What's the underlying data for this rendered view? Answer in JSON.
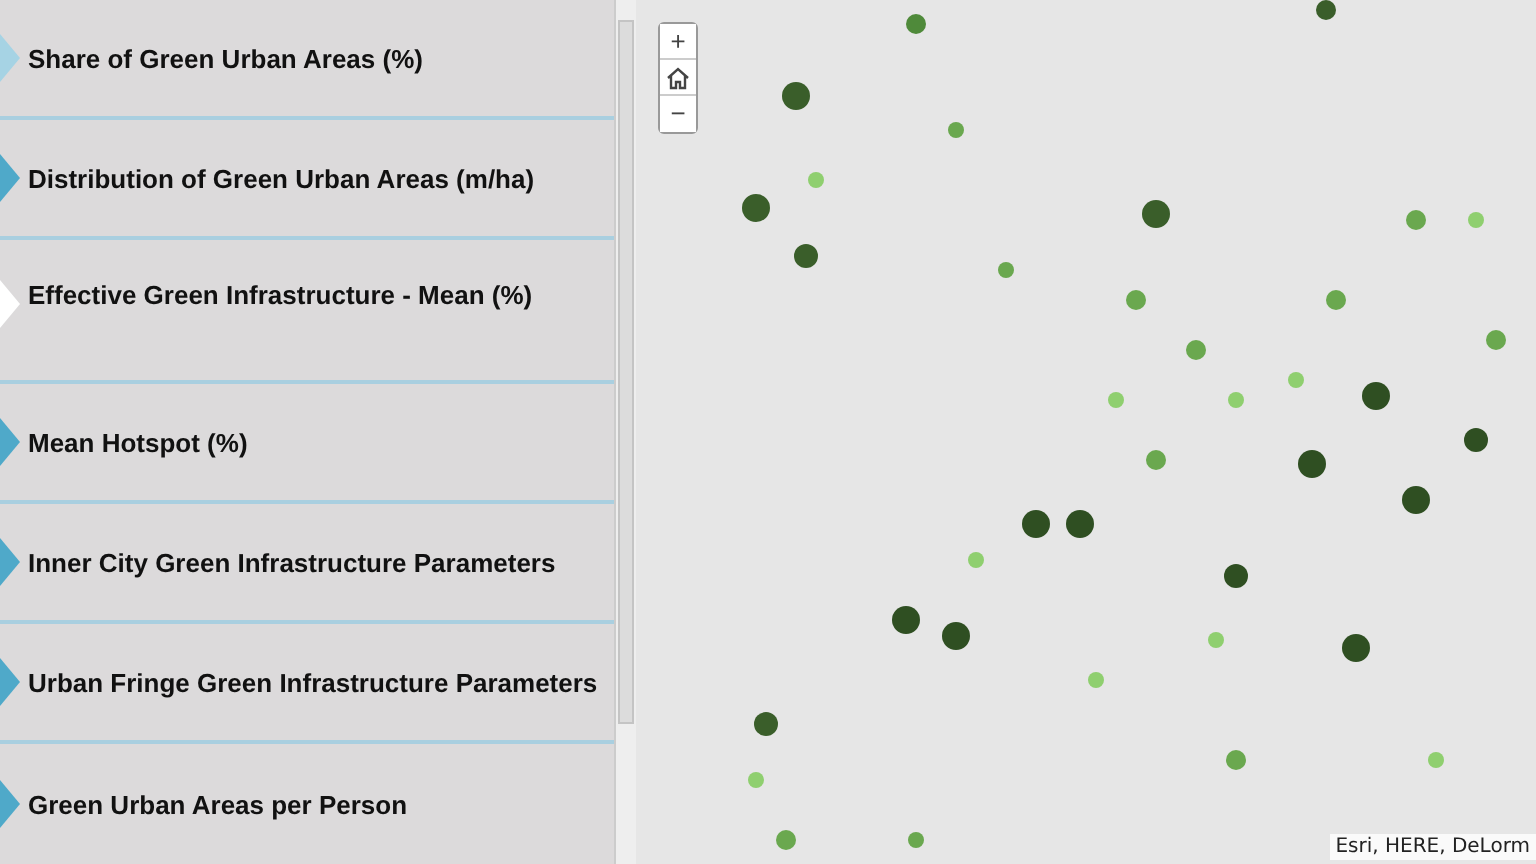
{
  "sidebar": {
    "items": [
      {
        "label": "Share of Green Urban Areas (%)",
        "selected": false,
        "hovered": true
      },
      {
        "label": "Distribution of Green Urban Areas (m/ha)",
        "selected": false,
        "hovered": false
      },
      {
        "label": "Effective Green Infrastructure - Mean (%)",
        "selected": true,
        "hovered": false
      },
      {
        "label": "Mean Hotspot (%)",
        "selected": false,
        "hovered": false
      },
      {
        "label": "Inner City Green Infrastructure Parameters",
        "selected": false,
        "hovered": false
      },
      {
        "label": "Urban Fringe Green Infrastructure Parameters",
        "selected": false,
        "hovered": false
      },
      {
        "label": "Green Urban Areas per Person",
        "selected": false,
        "hovered": false
      }
    ]
  },
  "map": {
    "zoom_in": "+",
    "zoom_out": "−",
    "attribution": "Esri, HERE, DeLorm"
  }
}
